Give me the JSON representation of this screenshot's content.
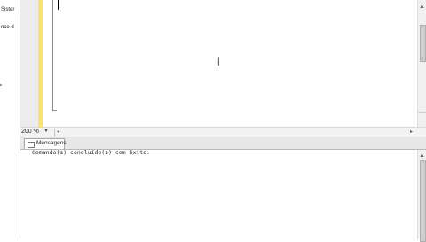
{
  "object_explorer": {
    "item1": "Sister",
    "item2": "nco d"
  },
  "editor": {
    "cursor_icon": "ibeam-cursor",
    "text_cursor": "|"
  },
  "status": {
    "zoom": "200 %",
    "zoom_arrow": "▼",
    "scroll_left": "◂",
    "scroll_right": "▸"
  },
  "results": {
    "tab_label": "Mensagens",
    "message": "Comando(s) concluído(s) com êxito."
  },
  "scrollbar": {
    "up_arrow": "▲"
  }
}
